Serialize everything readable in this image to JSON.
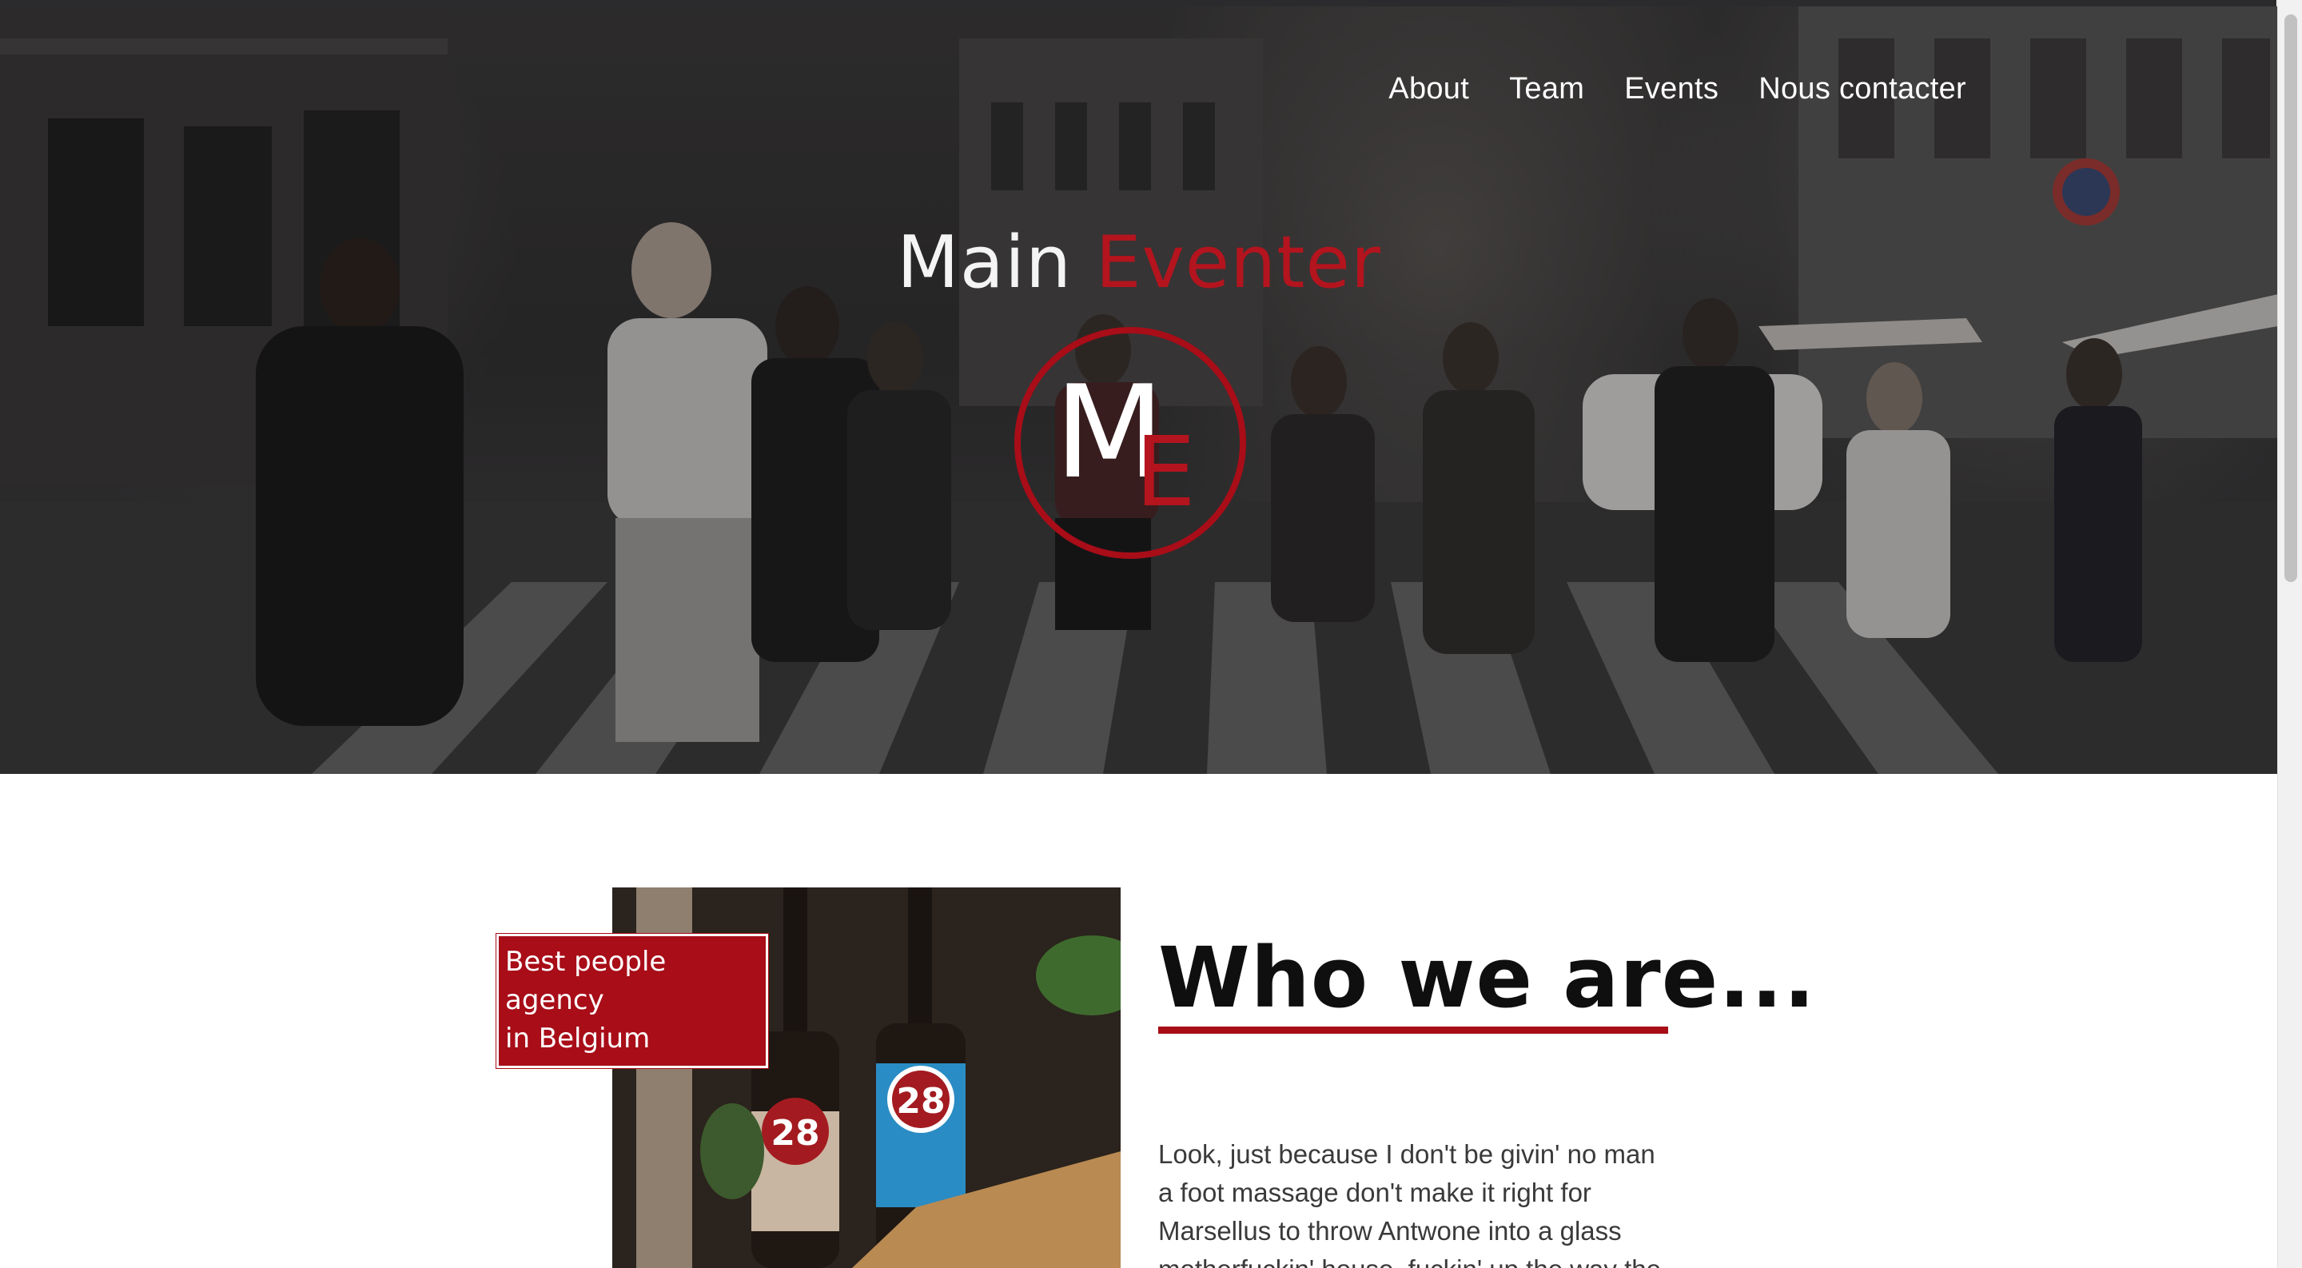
{
  "nav": {
    "items": [
      {
        "label": "About"
      },
      {
        "label": "Team"
      },
      {
        "label": "Events"
      },
      {
        "label": "Nous contacter"
      }
    ]
  },
  "brand": {
    "word1": "Main",
    "word2": "Eventer",
    "logo_letter1": "M",
    "logo_letter2": "E"
  },
  "about": {
    "badge_line1": "Best people agency",
    "badge_line2": "in Belgium",
    "title": "Who we are...",
    "body": "Look, just because I don't be givin' no man a foot massage don't make it right for Marsellus to throw Antwone into a glass motherfuckin' house, fuckin' up the way the"
  },
  "bottle_labels": {
    "bottle1_number": "28",
    "bottle2_number": "28"
  },
  "colors": {
    "accent": "#a80d18",
    "brand_red": "#b3141e",
    "text": "#3a3a3a"
  }
}
